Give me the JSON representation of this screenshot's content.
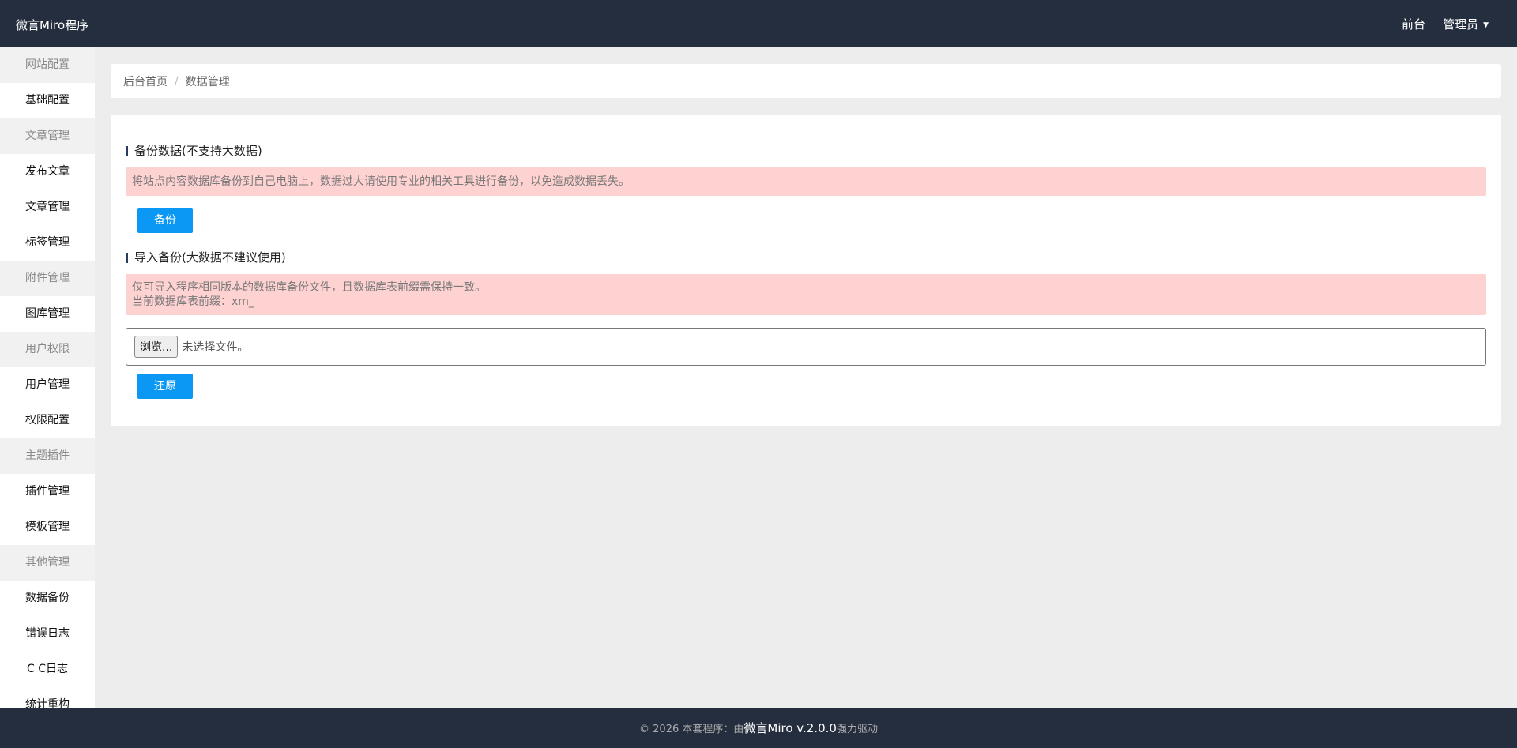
{
  "header": {
    "brand": "微言Miro程序",
    "nav": {
      "front": "前台",
      "admin": "管理员"
    }
  },
  "sidebar": {
    "items": [
      {
        "type": "group",
        "label": "网站配置"
      },
      {
        "type": "item",
        "label": "基础配置"
      },
      {
        "type": "group",
        "label": "文章管理"
      },
      {
        "type": "item",
        "label": "发布文章"
      },
      {
        "type": "item",
        "label": "文章管理"
      },
      {
        "type": "item",
        "label": "标签管理"
      },
      {
        "type": "group",
        "label": "附件管理"
      },
      {
        "type": "item",
        "label": "图库管理"
      },
      {
        "type": "group",
        "label": "用户权限"
      },
      {
        "type": "item",
        "label": "用户管理"
      },
      {
        "type": "item",
        "label": "权限配置"
      },
      {
        "type": "group",
        "label": "主题插件"
      },
      {
        "type": "item",
        "label": "插件管理"
      },
      {
        "type": "item",
        "label": "模板管理"
      },
      {
        "type": "group",
        "label": "其他管理"
      },
      {
        "type": "item",
        "label": "数据备份"
      },
      {
        "type": "item",
        "label": "错误日志"
      },
      {
        "type": "item",
        "label": "C C日志"
      },
      {
        "type": "item",
        "label": "统计重构"
      }
    ]
  },
  "breadcrumb": {
    "home": "后台首页",
    "separator": "/",
    "current": "数据管理"
  },
  "backup": {
    "title": "备份数据(不支持大数据)",
    "notice": "将站点内容数据库备份到自己电脑上，数据过大请使用专业的相关工具进行备份，以免造成数据丢失。",
    "button": "备份"
  },
  "restore": {
    "title": "导入备份(大数据不建议使用)",
    "notice_line1": "仅可导入程序相同版本的数据库备份文件，且数据库表前缀需保持一致。",
    "notice_line2": "当前数据库表前缀：xm_",
    "file_button": "浏览...",
    "file_status": "未选择文件。",
    "button": "还原"
  },
  "footer": {
    "prefix": "© 2026 本套程序：由",
    "product": "微言Miro v.2.0.0",
    "suffix": "强力驱动"
  }
}
